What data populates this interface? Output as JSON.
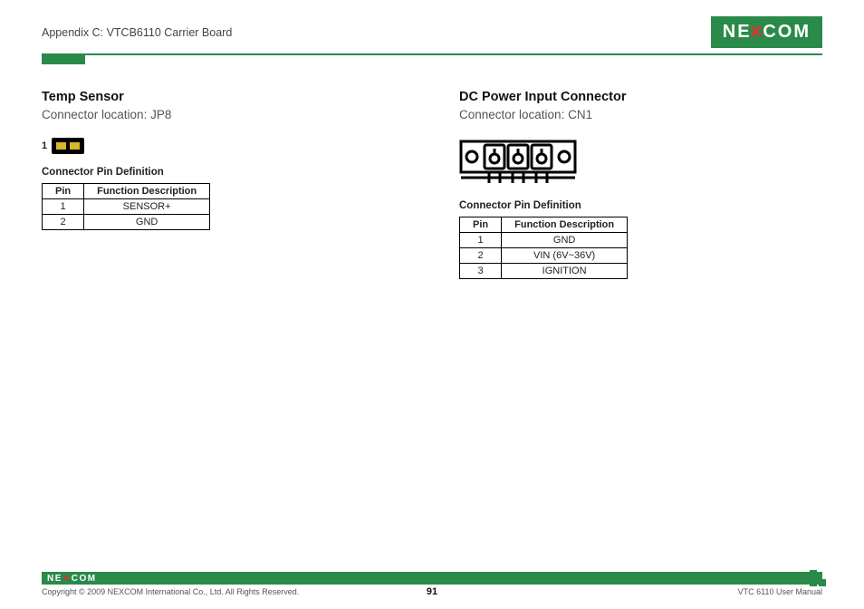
{
  "header": {
    "appendix": "Appendix C: VTCB6110 Carrier Board",
    "brand_left": "NE",
    "brand_right": "COM"
  },
  "left": {
    "title": "Temp Sensor",
    "location": "Connector location: JP8",
    "pin1_label": "1",
    "table_caption": "Connector Pin Definition",
    "headers": {
      "pin": "Pin",
      "func": "Function Description"
    },
    "rows": [
      {
        "pin": "1",
        "func": "SENSOR+"
      },
      {
        "pin": "2",
        "func": "GND"
      }
    ]
  },
  "right": {
    "title": "DC Power Input Connector",
    "location": "Connector location: CN1",
    "table_caption": "Connector Pin Definition",
    "headers": {
      "pin": "Pin",
      "func": "Function Description"
    },
    "rows": [
      {
        "pin": "1",
        "func": "GND"
      },
      {
        "pin": "2",
        "func": "VIN (6V~36V)"
      },
      {
        "pin": "3",
        "func": "IGNITION"
      }
    ]
  },
  "footer": {
    "brand_left": "NE",
    "brand_right": "COM",
    "copyright": "Copyright © 2009 NEXCOM International Co., Ltd. All Rights Reserved.",
    "page": "91",
    "manual": "VTC 6110 User Manual"
  }
}
